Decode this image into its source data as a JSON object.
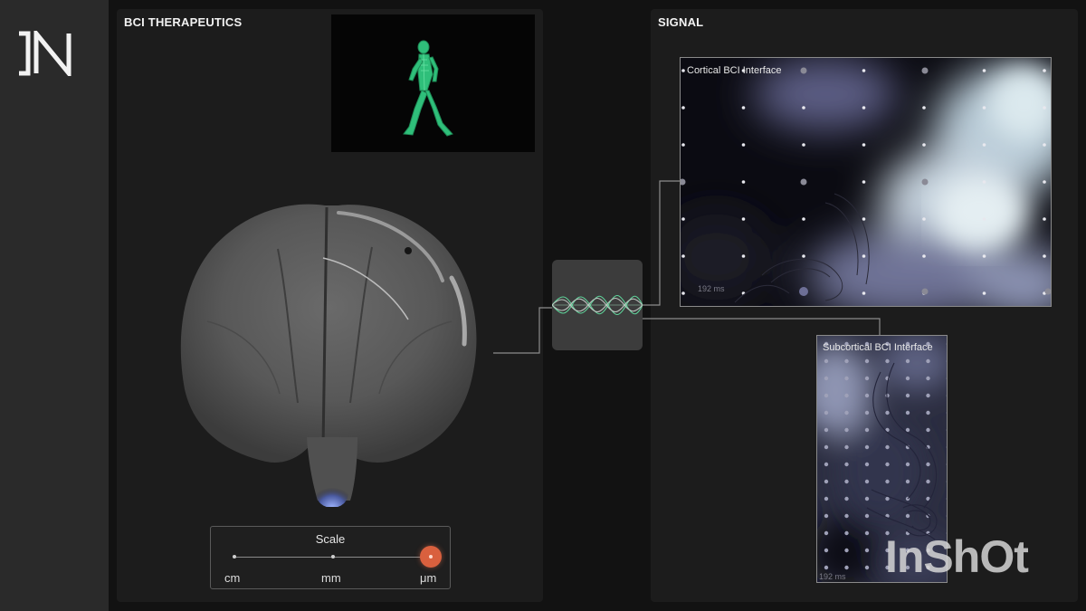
{
  "brand": {
    "logo_text": "JN"
  },
  "therapeutics": {
    "title": "BCI THERAPEUTICS",
    "scale": {
      "title": "Scale",
      "labels": [
        "cm",
        "mm",
        "μm"
      ],
      "selected": "μm",
      "accent_color": "#d9603e"
    }
  },
  "signal": {
    "title": "SIGNAL",
    "cortical": {
      "label": "Cortical BCI Interface",
      "time": "192 ms"
    },
    "subcortical": {
      "label": "Subcortical BCI Interface",
      "time": "192 ms"
    }
  },
  "colors": {
    "skeleton": "#2fbf7a",
    "wave_green": "#5fd39a",
    "wave_gray": "#bfc7c2"
  },
  "watermark": "InShOt"
}
